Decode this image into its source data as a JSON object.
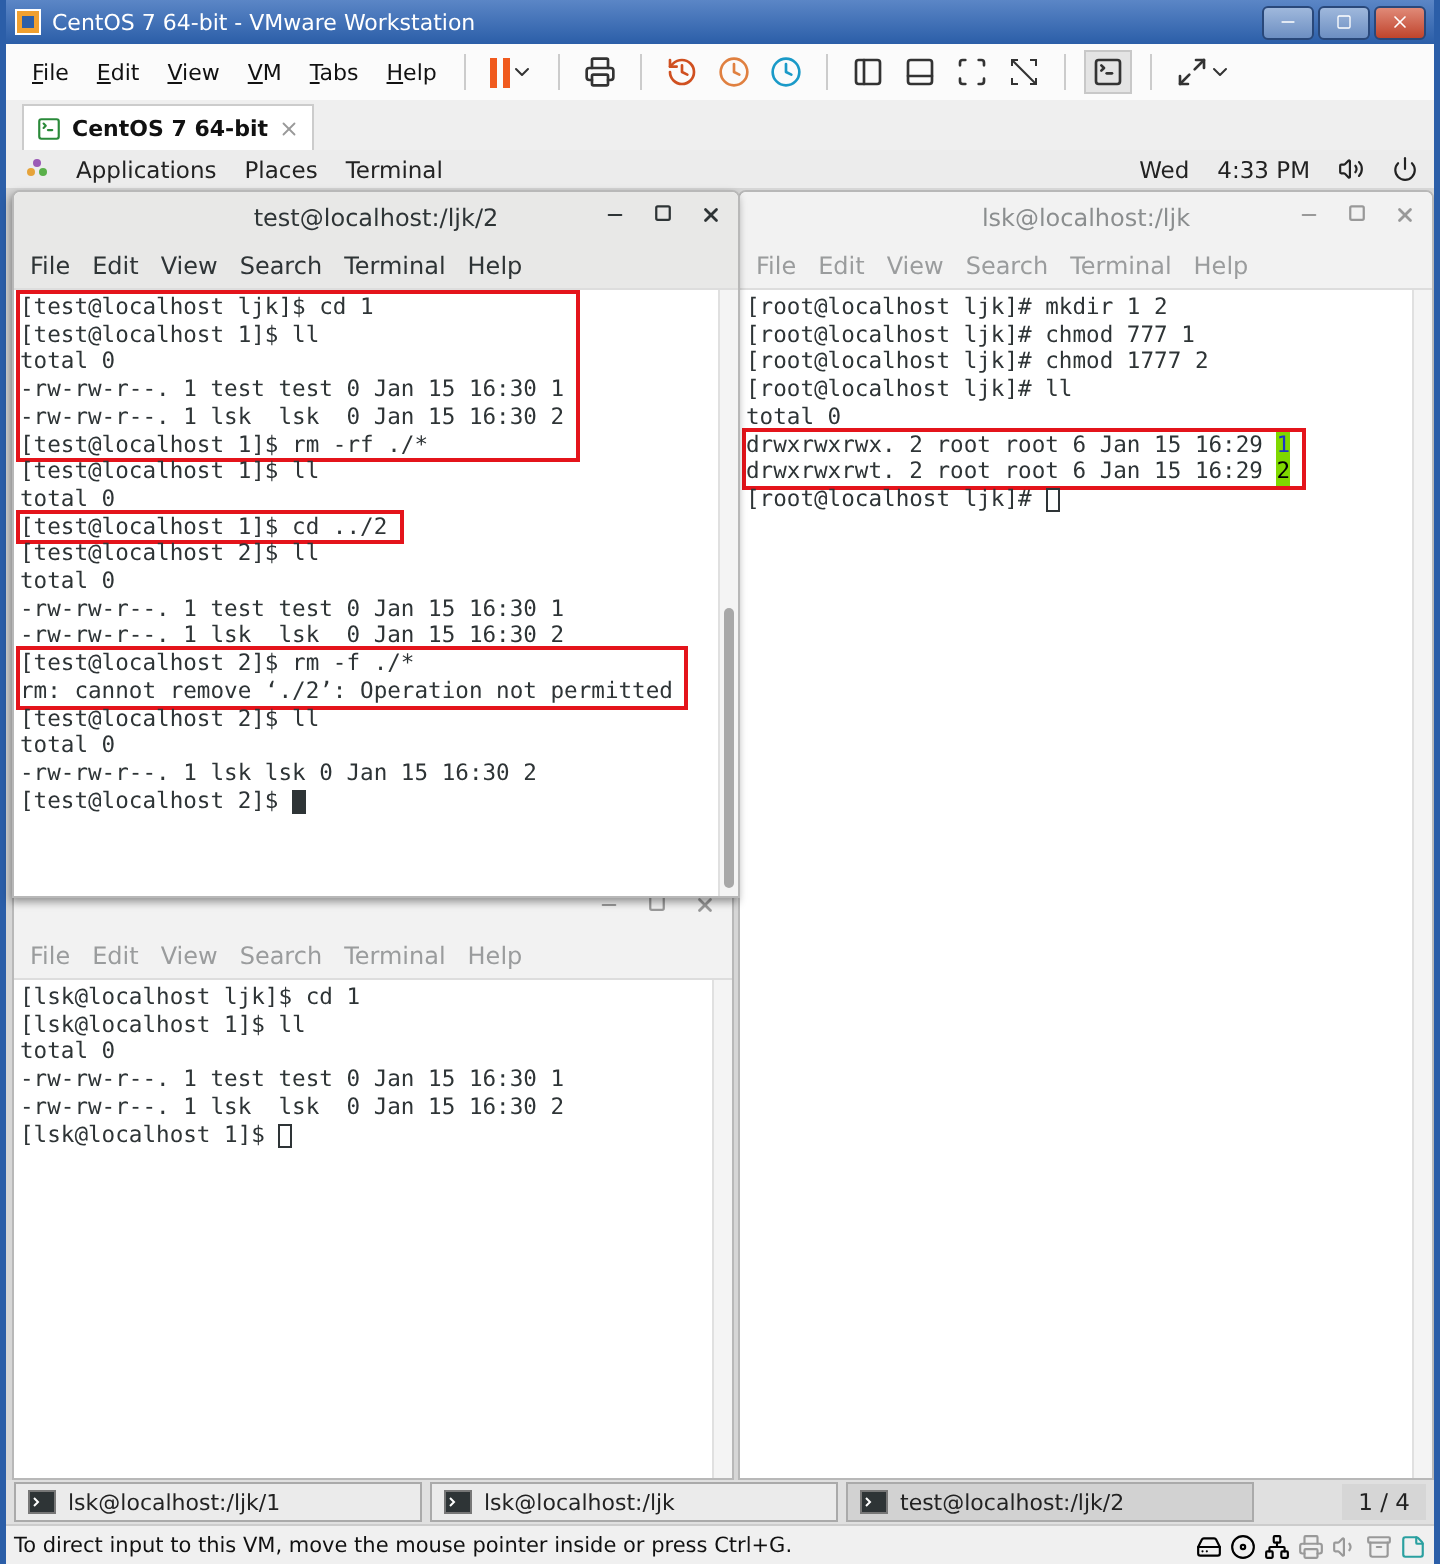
{
  "vmware": {
    "title": "CentOS 7 64-bit - VMware Workstation",
    "menu": [
      "File",
      "Edit",
      "View",
      "VM",
      "Tabs",
      "Help"
    ],
    "tab": {
      "label": "CentOS 7 64-bit"
    },
    "status_bar": "To direct input to this VM, move the mouse pointer inside or press Ctrl+G."
  },
  "gnome_bar": {
    "menus": [
      "Applications",
      "Places",
      "Terminal"
    ],
    "day": "Wed",
    "time": "4:33 PM"
  },
  "windows": [
    {
      "title": "test@localhost:/ljk/2",
      "active": true,
      "menu": [
        "File",
        "Edit",
        "View",
        "Search",
        "Terminal",
        "Help"
      ],
      "blocks": [
        {
          "highlighted": true,
          "lines": [
            {
              "text": "[test@localhost ljk]$ cd 1"
            },
            {
              "text": "[test@localhost 1]$ ll"
            },
            {
              "text": "total 0"
            },
            {
              "text": "-rw-rw-r--. 1 test test 0 Jan 15 16:30 1"
            },
            {
              "text": "-rw-rw-r--. 1 lsk  lsk  0 Jan 15 16:30 2"
            },
            {
              "text": "[test@localhost 1]$ rm -rf ./*"
            }
          ]
        },
        {
          "highlighted": false,
          "lines": [
            {
              "text": "[test@localhost 1]$ ll"
            },
            {
              "text": "total 0"
            }
          ]
        },
        {
          "highlighted": true,
          "lines": [
            {
              "text": "[test@localhost 1]$ cd ../2"
            }
          ]
        },
        {
          "highlighted": false,
          "lines": [
            {
              "text": "[test@localhost 2]$ ll"
            },
            {
              "text": "total 0"
            },
            {
              "text": "-rw-rw-r--. 1 test test 0 Jan 15 16:30 1"
            },
            {
              "text": "-rw-rw-r--. 1 lsk  lsk  0 Jan 15 16:30 2"
            }
          ]
        },
        {
          "highlighted": true,
          "lines": [
            {
              "text": "[test@localhost 2]$ rm -f ./*"
            },
            {
              "text": "rm: cannot remove ‘./2’: Operation not permitted"
            }
          ]
        },
        {
          "highlighted": false,
          "lines": [
            {
              "text": "[test@localhost 2]$ ll"
            },
            {
              "text": "total 0"
            },
            {
              "text": "-rw-rw-r--. 1 lsk lsk 0 Jan 15 16:30 2"
            },
            {
              "text": "[test@localhost 2]$ ",
              "cursor": {
                "filled": true
              }
            }
          ]
        }
      ]
    },
    {
      "title": "lsk@localhost:/ljk",
      "active": false,
      "menu": [
        "File",
        "Edit",
        "View",
        "Search",
        "Terminal",
        "Help"
      ],
      "blocks": [
        {
          "highlighted": false,
          "lines": [
            {
              "text": "[root@localhost ljk]# mkdir 1 2"
            },
            {
              "text": "[root@localhost ljk]# chmod 777 1"
            },
            {
              "text": "[root@localhost ljk]# chmod 1777 2"
            },
            {
              "text": "[root@localhost ljk]# ll"
            },
            {
              "text": "total 0"
            }
          ]
        },
        {
          "highlighted": true,
          "lines": [
            {
              "text": "drwxrwxrwx. 2 root root 6 Jan 15 16:29 ",
              "entry": {
                "name": "1",
                "sticky": false
              }
            },
            {
              "text": "drwxrwxrwt. 2 root root 6 Jan 15 16:29 ",
              "entry": {
                "name": "2",
                "sticky": true
              }
            }
          ]
        },
        {
          "highlighted": false,
          "lines": [
            {
              "text": "[root@localhost ljk]# ",
              "cursor": {
                "filled": false
              }
            }
          ]
        }
      ]
    },
    {
      "active": false,
      "menu": [
        "File",
        "Edit",
        "View",
        "Search",
        "Terminal",
        "Help"
      ],
      "blocks": [
        {
          "highlighted": false,
          "lines": [
            {
              "text": "[lsk@localhost ljk]$ cd 1"
            },
            {
              "text": "[lsk@localhost 1]$ ll"
            },
            {
              "text": "total 0"
            },
            {
              "text": "-rw-rw-r--. 1 test test 0 Jan 15 16:30 1"
            },
            {
              "text": "-rw-rw-r--. 1 lsk  lsk  0 Jan 15 16:30 2"
            },
            {
              "text": "[lsk@localhost 1]$ ",
              "cursor": {
                "filled": false
              }
            }
          ]
        }
      ]
    }
  ],
  "taskbar": {
    "items": [
      {
        "label": "lsk@localhost:/ljk/1",
        "selected": false
      },
      {
        "label": "lsk@localhost:/ljk",
        "selected": false
      },
      {
        "label": "test@localhost:/ljk/2",
        "selected": true
      }
    ],
    "pager": "1 / 4"
  }
}
